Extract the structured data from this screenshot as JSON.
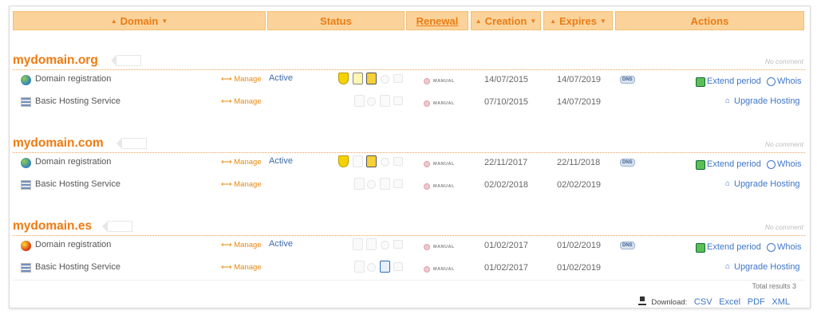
{
  "header": {
    "domain": "Domain",
    "status": "Status",
    "renewal": "Renewal",
    "creation": "Creation",
    "expires": "Expires",
    "actions": "Actions"
  },
  "groups": [
    {
      "name": "mydomain.org",
      "comment": "No comment",
      "rows": [
        {
          "service": "Domain registration",
          "manage": "Manage",
          "status": "Active",
          "renewal": "MANUAL",
          "creation": "14/07/2015",
          "expires": "14/07/2019",
          "dns": "DNS",
          "extend": "Extend period",
          "whois": "Whois"
        },
        {
          "service": "Basic Hosting Service",
          "manage": "Manage",
          "renewal": "MANUAL",
          "creation": "07/10/2015",
          "expires": "14/07/2019",
          "upgrade": "Upgrade Hosting"
        }
      ]
    },
    {
      "name": "mydomain.com",
      "comment": "No comment",
      "rows": [
        {
          "service": "Domain registration",
          "manage": "Manage",
          "status": "Active",
          "renewal": "MANUAL",
          "creation": "22/11/2017",
          "expires": "22/11/2018",
          "dns": "DNS",
          "extend": "Extend period",
          "whois": "Whois"
        },
        {
          "service": "Basic Hosting Service",
          "manage": "Manage",
          "renewal": "MANUAL",
          "creation": "02/02/2018",
          "expires": "02/02/2019",
          "upgrade": "Upgrade Hosting"
        }
      ]
    },
    {
      "name": "mydomain.es",
      "comment": "No comment",
      "rows": [
        {
          "service": "Domain registration",
          "manage": "Manage",
          "status": "Active",
          "renewal": "MANUAL",
          "creation": "01/02/2017",
          "expires": "01/02/2019",
          "dns": "DNS",
          "extend": "Extend period",
          "whois": "Whois"
        },
        {
          "service": "Basic Hosting Service",
          "manage": "Manage",
          "renewal": "MANUAL",
          "creation": "01/02/2017",
          "expires": "01/02/2019",
          "upgrade": "Upgrade Hosting"
        }
      ]
    }
  ],
  "footer": {
    "total": "Total results 3",
    "download_label": "Download:",
    "formats": [
      "CSV",
      "Excel",
      "PDF",
      "XML"
    ]
  },
  "icons": {
    "domain_service": "globe-icon",
    "hosting_service": "server-icon",
    "status": [
      "shield-icon",
      "lock-icon",
      "transfer-lock-icon",
      "clock-icon",
      "refresh-icon"
    ],
    "renewal": "manual-renewal-dot-icon",
    "extend": "extend-period-icon",
    "whois": "whois-user-icon",
    "upgrade": "upgrade-home-icon",
    "download": "download-icon"
  },
  "colors": {
    "accent": "#f07a10",
    "header_bg": "#fbd39a",
    "link": "#3f76c9"
  }
}
